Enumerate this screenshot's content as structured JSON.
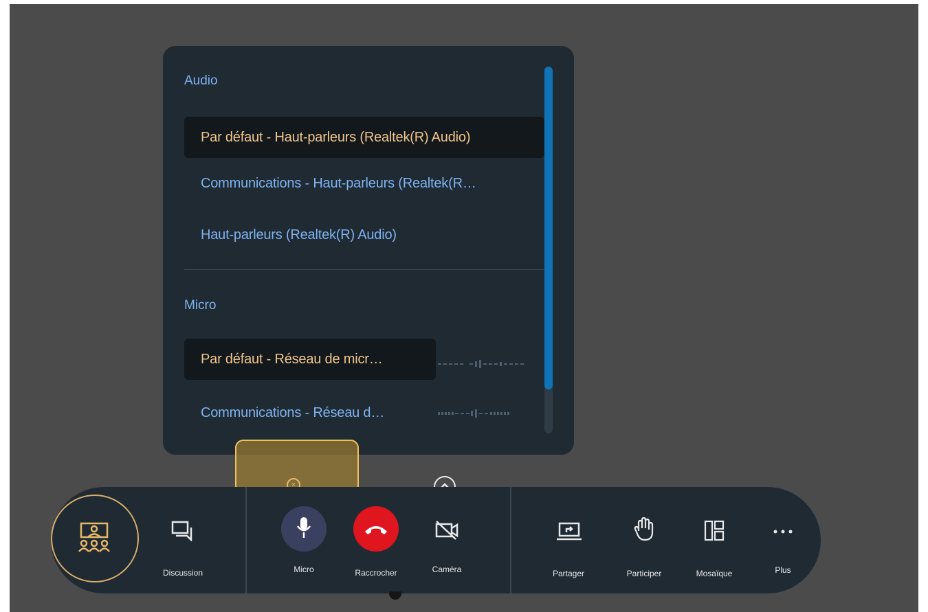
{
  "device_panel": {
    "audio_title": "Audio",
    "audio_devices": [
      {
        "label": "Par défaut - Haut-parleurs (Realtek(R) Audio)",
        "selected": true
      },
      {
        "label": "Communications - Haut-parleurs (Realtek(R…",
        "selected": false
      },
      {
        "label": "Haut-parleurs (Realtek(R) Audio)",
        "selected": false
      }
    ],
    "micro_title": "Micro",
    "micro_devices": [
      {
        "label": "Par défaut - Réseau de micr…",
        "selected": true
      },
      {
        "label": "Communications - Réseau d…",
        "selected": false
      }
    ]
  },
  "control_bar": {
    "discussion_label": "Discussion",
    "micro_label": "Micro",
    "hangup_label": "Raccrocher",
    "camera_label": "Caméra",
    "share_label": "Partager",
    "participate_label": "Participer",
    "mosaic_label": "Mosaïque",
    "more_label": "Plus"
  },
  "colors": {
    "panel_bg": "#1f2a33",
    "accent_text": "#7fb2f0",
    "selected_text": "#f0c58e",
    "hangup_red": "#e0161f",
    "mic_button": "#3a4160",
    "highlight_border": "#f0c25a"
  }
}
